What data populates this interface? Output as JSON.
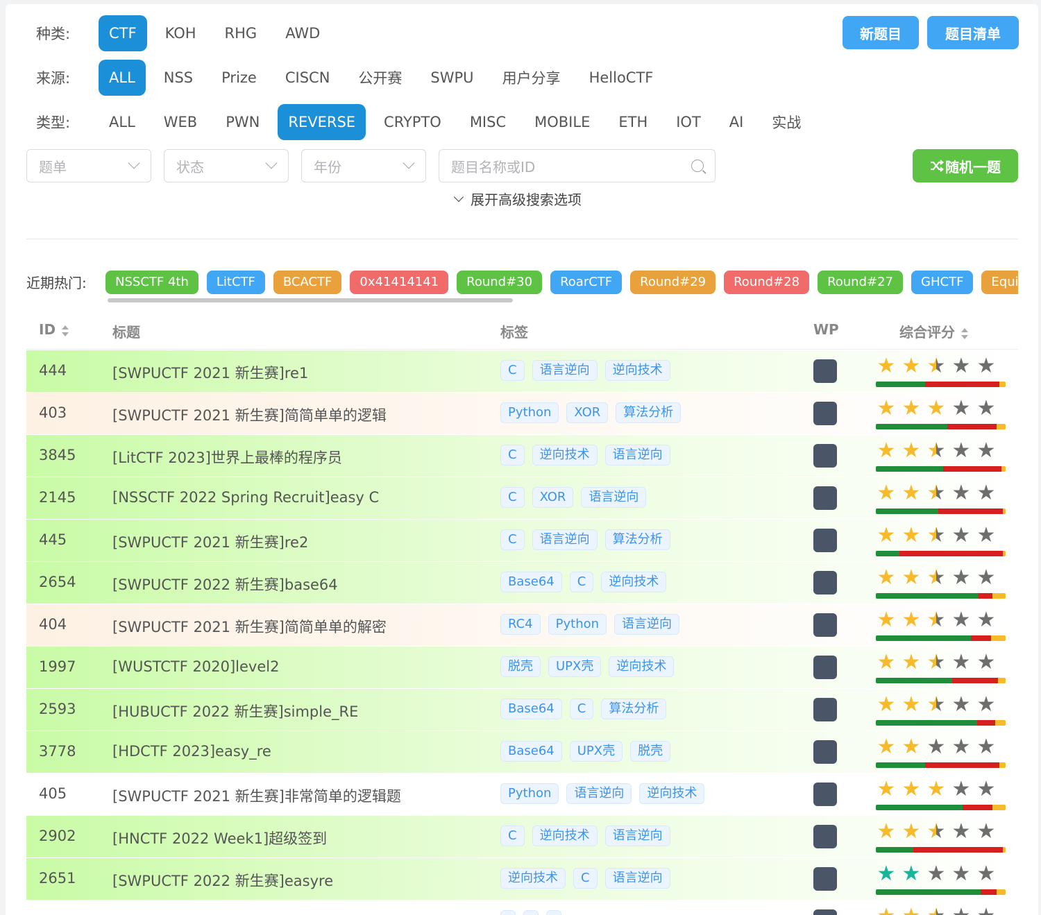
{
  "filters": {
    "kind": {
      "label": "种类:",
      "options": [
        "CTF",
        "KOH",
        "RHG",
        "AWD"
      ],
      "active": 0
    },
    "source": {
      "label": "来源:",
      "options": [
        "ALL",
        "NSS",
        "Prize",
        "CISCN",
        "公开赛",
        "SWPU",
        "用户分享",
        "HelloCTF"
      ],
      "active": 0
    },
    "type": {
      "label": "类型:",
      "options": [
        "ALL",
        "WEB",
        "PWN",
        "REVERSE",
        "CRYPTO",
        "MISC",
        "MOBILE",
        "ETH",
        "IOT",
        "AI",
        "实战"
      ],
      "active": 3
    }
  },
  "header_buttons": {
    "new": "新题目",
    "list": "题目清单"
  },
  "search": {
    "list_placeholder": "题单",
    "status_placeholder": "状态",
    "year_placeholder": "年份",
    "query_placeholder": "题目名称或ID",
    "random_label": "随机一题",
    "advanced_label": "展开高级搜索选项"
  },
  "hot": {
    "label": "近期热门:",
    "tags": [
      {
        "text": "NSSCTF 4th",
        "color": "#5ec245"
      },
      {
        "text": "LitCTF",
        "color": "#41a6f4"
      },
      {
        "text": "BCACTF",
        "color": "#e9a23b"
      },
      {
        "text": "0x41414141",
        "color": "#f26b6b"
      },
      {
        "text": "Round#30",
        "color": "#5ec245"
      },
      {
        "text": "RoarCTF",
        "color": "#41a6f4"
      },
      {
        "text": "Round#29",
        "color": "#e9a23b"
      },
      {
        "text": "Round#28",
        "color": "#f26b6b"
      },
      {
        "text": "Round#27",
        "color": "#5ec245"
      },
      {
        "text": "GHCTF",
        "color": "#41a6f4"
      },
      {
        "text": "Equinor",
        "color": "#e9a23b"
      }
    ]
  },
  "table": {
    "headers": {
      "id": "ID",
      "title": "标题",
      "tags": "标签",
      "wp": "WP",
      "score": "综合评分"
    },
    "rows": [
      {
        "id": "444",
        "title": "[SWPUCTF 2021 新生赛]re1",
        "tags": [
          "C",
          "语言逆向",
          "逆向技术"
        ],
        "bg": "green",
        "stars": 2.5,
        "star_color": "gold",
        "bar": [
          0.38,
          0.57,
          0.05
        ]
      },
      {
        "id": "403",
        "title": "[SWPUCTF 2021 新生赛]简简单单的逻辑",
        "tags": [
          "Python",
          "XOR",
          "算法分析"
        ],
        "bg": "peach",
        "stars": 3,
        "star_color": "gold",
        "bar": [
          0.55,
          0.38,
          0.07
        ]
      },
      {
        "id": "3845",
        "title": "[LitCTF 2023]世界上最棒的程序员",
        "tags": [
          "C",
          "逆向技术",
          "语言逆向"
        ],
        "bg": "green",
        "stars": 2.5,
        "star_color": "gold",
        "bar": [
          0.52,
          0.45,
          0.03
        ]
      },
      {
        "id": "2145",
        "title": "[NSSCTF 2022 Spring Recruit]easy C",
        "tags": [
          "C",
          "XOR",
          "语言逆向"
        ],
        "bg": "green",
        "stars": 2.5,
        "star_color": "gold",
        "bar": [
          0.48,
          0.5,
          0.02
        ]
      },
      {
        "id": "445",
        "title": "[SWPUCTF 2021 新生赛]re2",
        "tags": [
          "C",
          "语言逆向",
          "算法分析"
        ],
        "bg": "green",
        "stars": 2.5,
        "star_color": "gold",
        "bar": [
          0.18,
          0.8,
          0.02
        ]
      },
      {
        "id": "2654",
        "title": "[SWPUCTF 2022 新生赛]base64",
        "tags": [
          "Base64",
          "C",
          "逆向技术"
        ],
        "bg": "green",
        "stars": 2.5,
        "star_color": "gold",
        "bar": [
          0.79,
          0.11,
          0.1
        ]
      },
      {
        "id": "404",
        "title": "[SWPUCTF 2021 新生赛]简简单单的解密",
        "tags": [
          "RC4",
          "Python",
          "语言逆向"
        ],
        "bg": "peach",
        "stars": 2.5,
        "star_color": "gold",
        "bar": [
          0.73,
          0.16,
          0.11
        ]
      },
      {
        "id": "1997",
        "title": "[WUSTCTF 2020]level2",
        "tags": [
          "脱壳",
          "UPX壳",
          "逆向技术"
        ],
        "bg": "green",
        "stars": 2.5,
        "star_color": "gold",
        "bar": [
          0.59,
          0.35,
          0.06
        ]
      },
      {
        "id": "2593",
        "title": "[HUBUCTF 2022 新生赛]simple_RE",
        "tags": [
          "Base64",
          "C",
          "算法分析"
        ],
        "bg": "green",
        "stars": 2.5,
        "star_color": "gold",
        "bar": [
          0.78,
          0.14,
          0.08
        ]
      },
      {
        "id": "3778",
        "title": "[HDCTF 2023]easy_re",
        "tags": [
          "Base64",
          "UPX壳",
          "脱壳"
        ],
        "bg": "green",
        "stars": 2,
        "star_color": "gold",
        "bar": [
          0.38,
          0.57,
          0.05
        ]
      },
      {
        "id": "405",
        "title": "[SWPUCTF 2021 新生赛]非常简单的逻辑题",
        "tags": [
          "Python",
          "语言逆向",
          "逆向技术"
        ],
        "bg": "white",
        "stars": 3,
        "star_color": "gold",
        "bar": [
          0.67,
          0.23,
          0.1
        ]
      },
      {
        "id": "2902",
        "title": "[HNCTF 2022 Week1]超级签到",
        "tags": [
          "C",
          "逆向技术",
          "语言逆向"
        ],
        "bg": "green",
        "stars": 2.5,
        "star_color": "gold",
        "bar": [
          0.29,
          0.69,
          0.02
        ]
      },
      {
        "id": "2651",
        "title": "[SWPUCTF 2022 新生赛]easyre",
        "tags": [
          "逆向技术",
          "C",
          "语言逆向"
        ],
        "bg": "green",
        "stars": 2,
        "star_color": "teal",
        "bar": [
          0.81,
          0.12,
          0.07
        ]
      },
      {
        "id": "",
        "title": "",
        "tags": [
          "",
          "",
          ""
        ],
        "bg": "white",
        "stars": 2.5,
        "star_color": "gold",
        "bar": [
          0.6,
          0.3,
          0.1
        ]
      }
    ]
  }
}
